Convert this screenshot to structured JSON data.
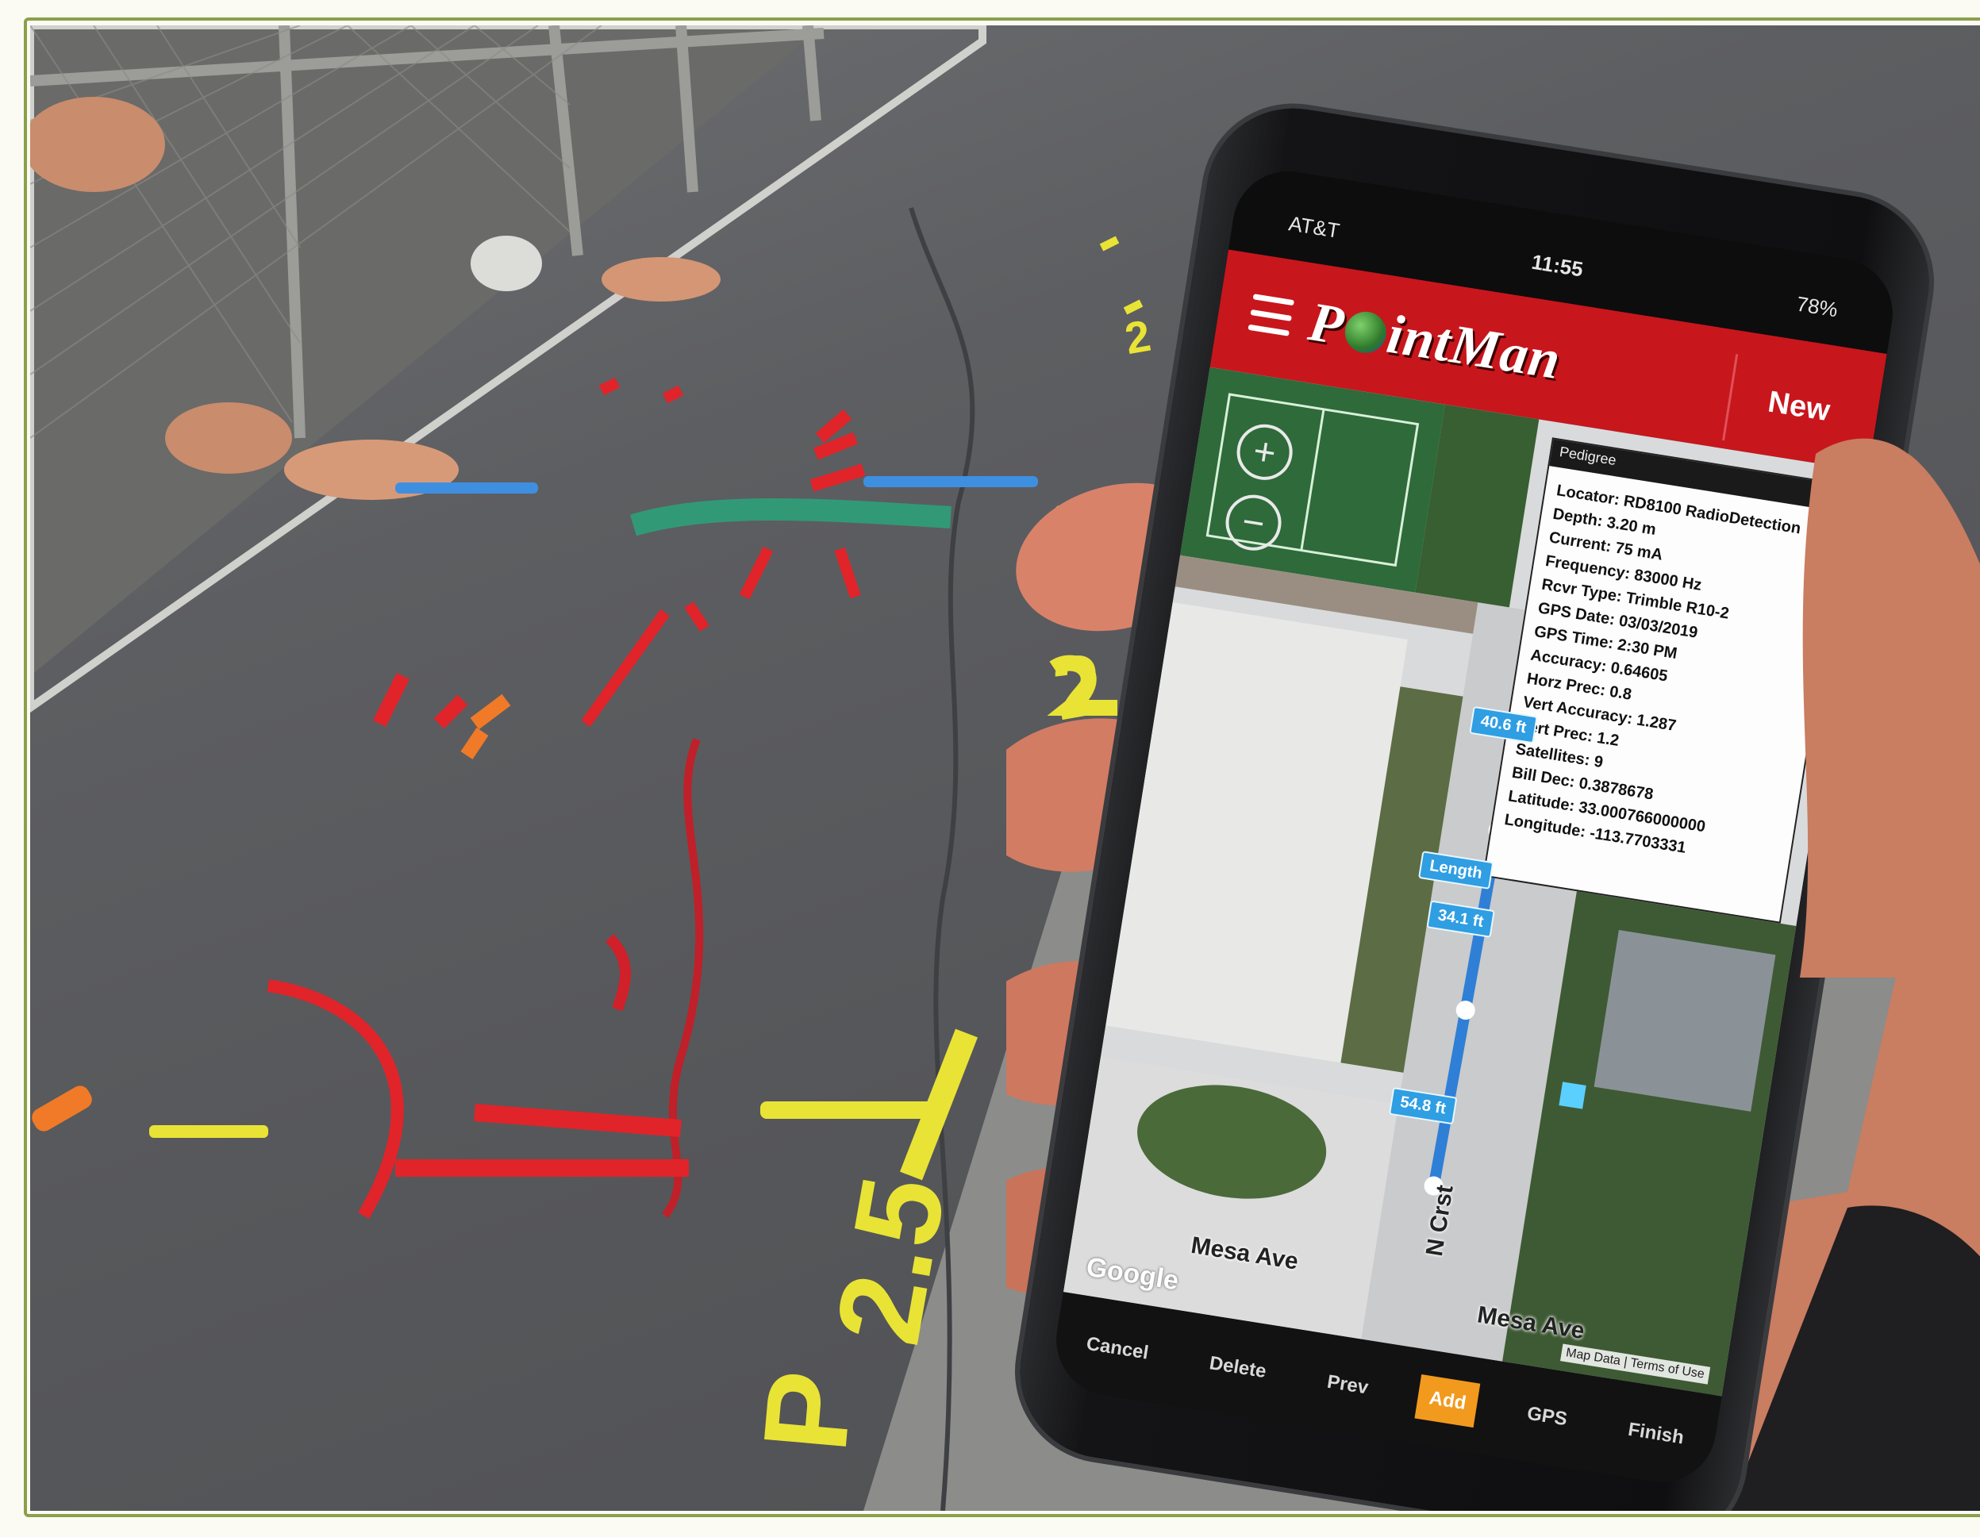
{
  "phone": {
    "status": {
      "carrier": "AT&T",
      "time": "11:55",
      "battery": "78%"
    },
    "app": {
      "name_prefix": "P",
      "name_suffix": "intMan",
      "new_label": "New"
    },
    "info_panel": {
      "title": "Pedigree",
      "close": "×",
      "lines": [
        "Locator: RD8100 RadioDetection",
        "Depth: 3.20 m",
        "Current: 75 mA",
        "Frequency: 83000 Hz",
        "Rcvr Type: Trimble R10-2",
        "GPS Date: 03/03/2019",
        "GPS Time: 2:30 PM",
        "Accuracy: 0.64605",
        "Horz Prec: 0.8",
        "Vert Accuracy: 1.287",
        "Vert Prec: 1.2",
        "Satellites: 9",
        "Bill Dec: 0.3878678",
        "Latitude: 33.000766000000",
        "Longitude: -113.7703331"
      ]
    },
    "map": {
      "zoom_in": "+",
      "zoom_out": "−",
      "segment_labels": [
        "40.6 ft",
        "Length",
        "34.1 ft",
        "54.8 ft"
      ],
      "streets": [
        "Mesa Ave",
        "Mesa Ave",
        "N Crst"
      ],
      "google": "Google",
      "attribution": "Map Data | Terms of Use"
    },
    "bottom_tabs": [
      {
        "label": "Cancel",
        "active": false
      },
      {
        "label": "Delete",
        "active": false
      },
      {
        "label": "Prev",
        "active": false
      },
      {
        "label": "Add",
        "active": true
      },
      {
        "label": "GPS",
        "active": false
      },
      {
        "label": "Finish",
        "active": false
      }
    ]
  },
  "ground_marks": [
    "2",
    "2",
    "2.5",
    "P"
  ],
  "colors": {
    "app_red": "#c8161d",
    "active_tab": "#f29a1e",
    "segment_blue": "#2f9ee3",
    "frame_green": "#8aa04a",
    "paint_red": "#e0242a",
    "paint_yellow": "#e9e336",
    "paint_orange": "#f07a28",
    "paint_blue": "#3f8fe0",
    "paint_green": "#2aa37a"
  }
}
